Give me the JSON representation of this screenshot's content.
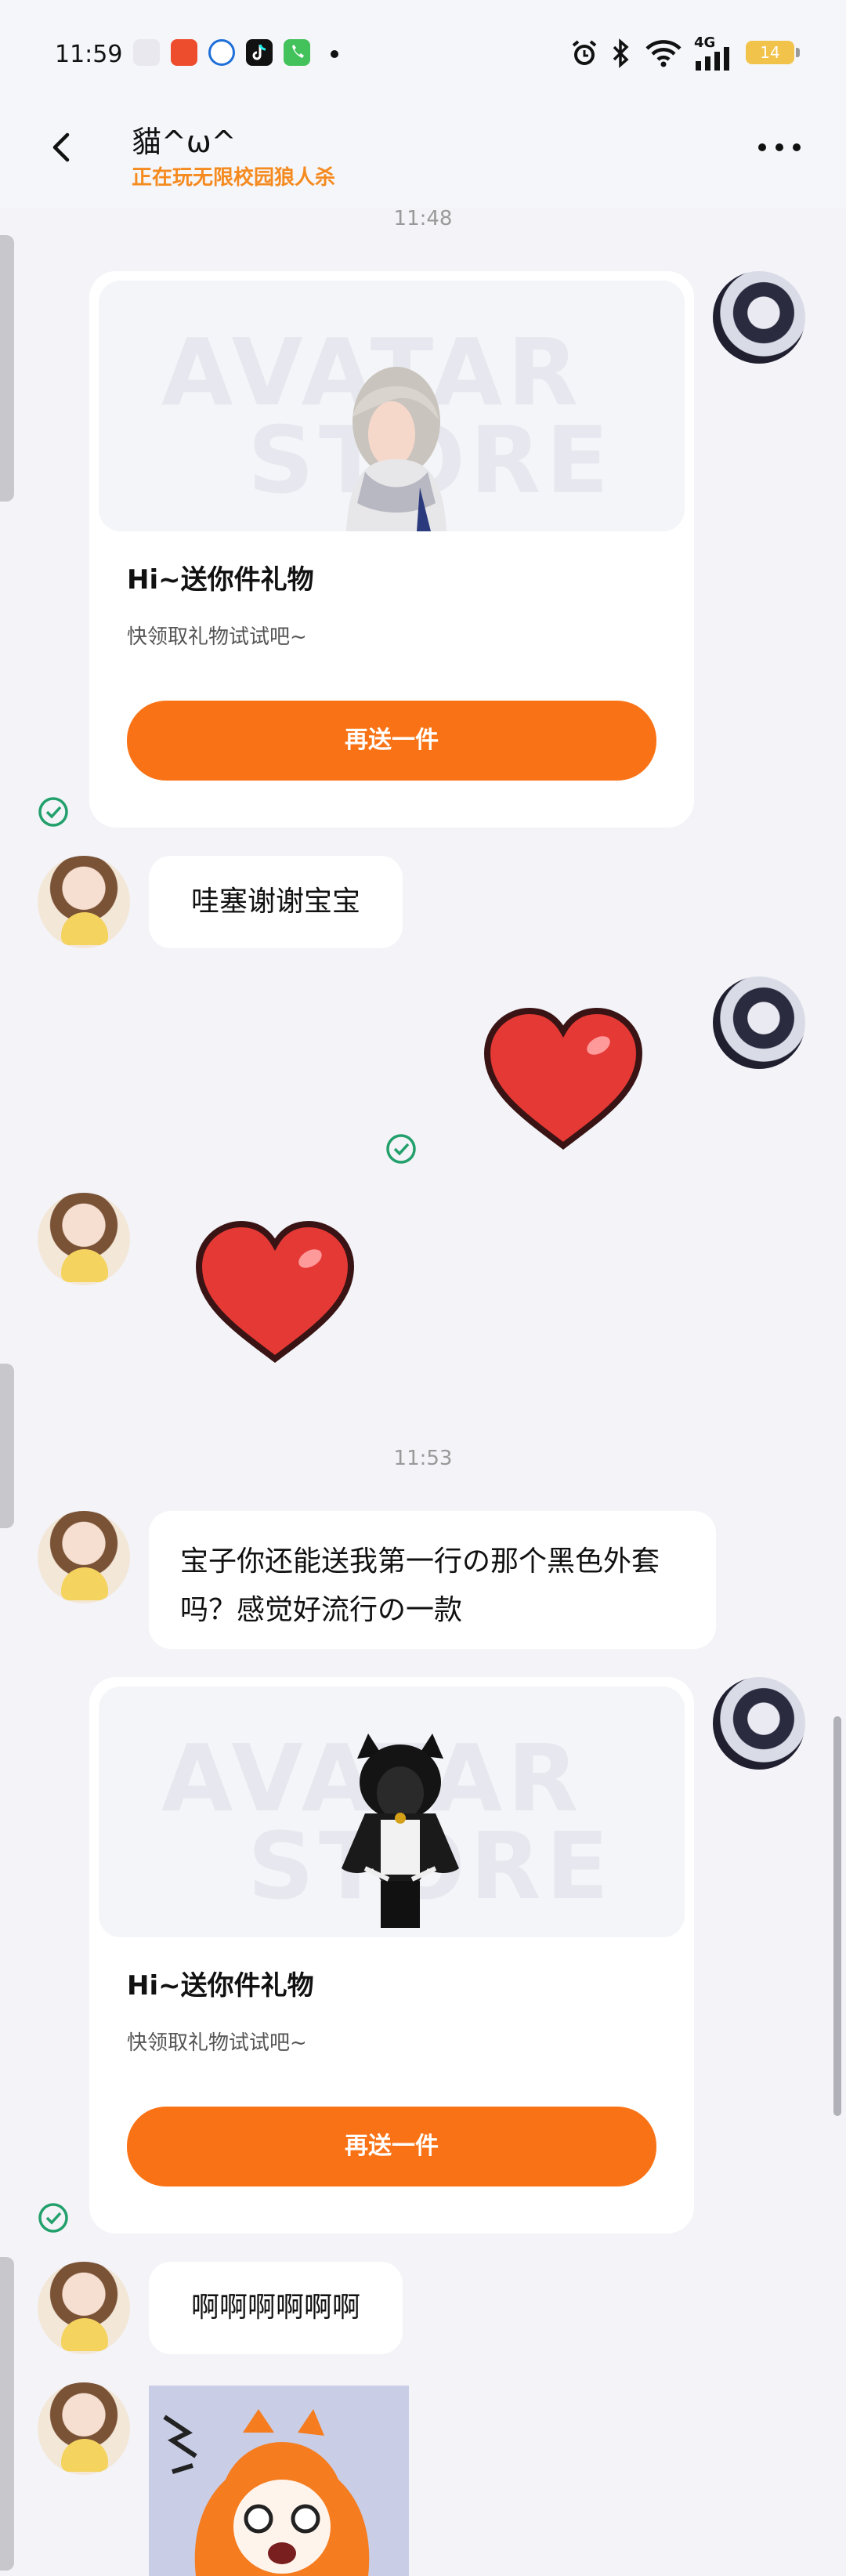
{
  "status_bar": {
    "time": "11:59",
    "network": "4G",
    "battery": "14",
    "app_icons": [
      "notification-app-icon",
      "notification-app-icon",
      "notification-app-icon",
      "tiktok-icon",
      "phone-icon"
    ]
  },
  "header": {
    "contact_name": "貓^ω^",
    "contact_status": "正在玩无限校园狼人杀"
  },
  "chat": {
    "time_1": "11:48",
    "time_2": "11:53",
    "gift_1": {
      "watermark_top": "AVATAR",
      "watermark_bottom": "STORE",
      "title": "Hi~送你件礼物",
      "subtitle": "快领取礼物试试吧~",
      "button": "再送一件"
    },
    "msg_1": "哇塞谢谢宝宝",
    "msg_2": "宝子你还能送我第一行の那个黑色外套吗？感觉好流行の一款",
    "gift_2": {
      "watermark_top": "AVATAR",
      "watermark_bottom": "STORE",
      "title": "Hi~送你件礼物",
      "subtitle": "快领取礼物试试吧~",
      "button": "再送一件"
    },
    "msg_3": "啊啊啊啊啊啊"
  },
  "colors": {
    "accent": "#f97316",
    "status_orange": "#f58a1f",
    "check_green": "#22a06b",
    "heart_red": "#e53935"
  }
}
